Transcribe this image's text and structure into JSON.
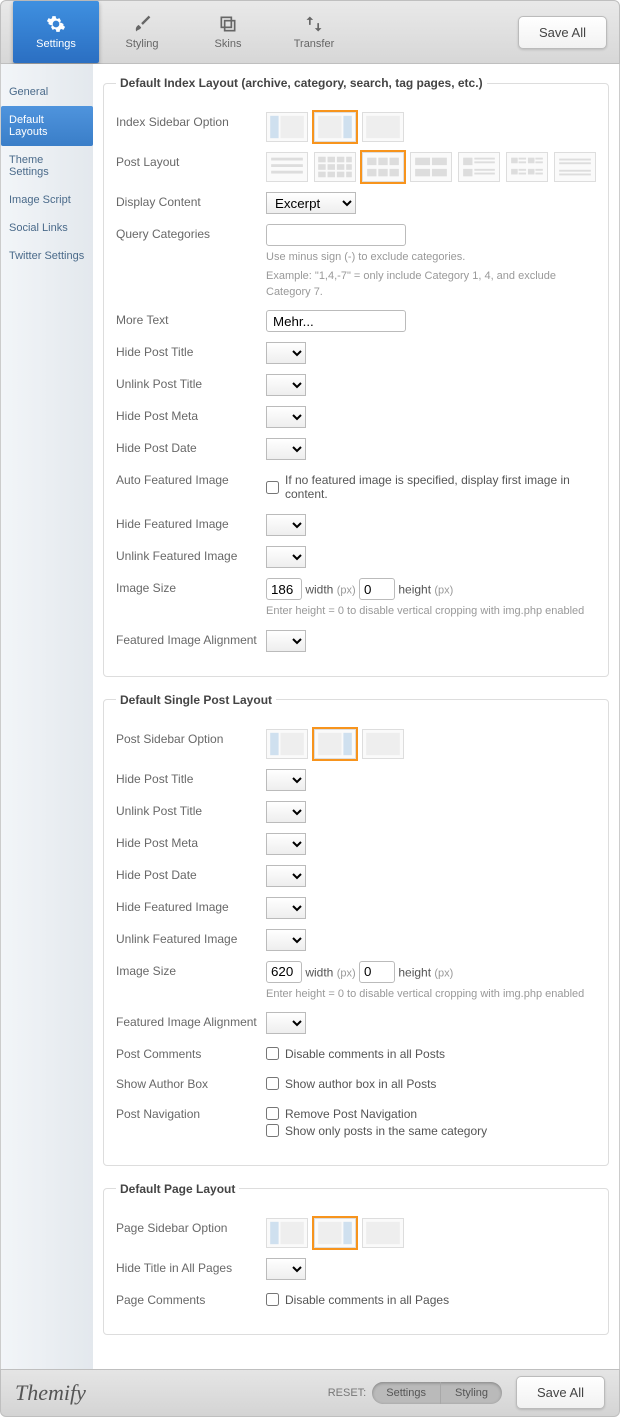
{
  "topbar": {
    "tabs": [
      {
        "label": "Settings",
        "active": true
      },
      {
        "label": "Styling",
        "active": false
      },
      {
        "label": "Skins",
        "active": false
      },
      {
        "label": "Transfer",
        "active": false
      }
    ],
    "save": "Save All"
  },
  "sidebar": {
    "items": [
      {
        "label": "General",
        "active": false
      },
      {
        "label": "Default Layouts",
        "active": true
      },
      {
        "label": "Theme Settings",
        "active": false
      },
      {
        "label": "Image Script",
        "active": false
      },
      {
        "label": "Social Links",
        "active": false
      },
      {
        "label": "Twitter Settings",
        "active": false
      }
    ]
  },
  "sections": {
    "index": {
      "legend": "Default Index Layout (archive, category, search, tag pages, etc.)",
      "sidebar_option": {
        "label": "Index Sidebar Option",
        "selected": 1,
        "count": 3
      },
      "post_layout": {
        "label": "Post Layout",
        "selected": 2,
        "count": 7
      },
      "display_content": {
        "label": "Display Content",
        "value": "Excerpt"
      },
      "query_categories": {
        "label": "Query Categories",
        "value": "",
        "hint1": "Use minus sign (-) to exclude categories.",
        "hint2": "Example: \"1,4,-7\" = only include Category 1, 4, and exclude Category 7."
      },
      "more_text": {
        "label": "More Text",
        "value": "Mehr..."
      },
      "hide_post_title": {
        "label": "Hide Post Title"
      },
      "unlink_post_title": {
        "label": "Unlink Post Title"
      },
      "hide_post_meta": {
        "label": "Hide Post Meta"
      },
      "hide_post_date": {
        "label": "Hide Post Date"
      },
      "auto_featured": {
        "label": "Auto Featured Image",
        "check_label": "If no featured image is specified, display first image in content."
      },
      "hide_featured": {
        "label": "Hide Featured Image"
      },
      "unlink_featured": {
        "label": "Unlink Featured Image"
      },
      "image_size": {
        "label": "Image Size",
        "w": "186",
        "h": "0",
        "w_lbl": "width",
        "h_lbl": "height",
        "px": "(px)",
        "hint": "Enter height = 0 to disable vertical cropping with img.php enabled"
      },
      "featured_align": {
        "label": "Featured Image Alignment"
      }
    },
    "single": {
      "legend": "Default Single Post Layout",
      "sidebar_option": {
        "label": "Post Sidebar Option",
        "selected": 1,
        "count": 3
      },
      "hide_post_title": {
        "label": "Hide Post Title"
      },
      "unlink_post_title": {
        "label": "Unlink Post Title"
      },
      "hide_post_meta": {
        "label": "Hide Post Meta"
      },
      "hide_post_date": {
        "label": "Hide Post Date"
      },
      "hide_featured": {
        "label": "Hide Featured Image"
      },
      "unlink_featured": {
        "label": "Unlink Featured Image"
      },
      "image_size": {
        "label": "Image Size",
        "w": "620",
        "h": "0",
        "w_lbl": "width",
        "h_lbl": "height",
        "px": "(px)",
        "hint": "Enter height = 0 to disable vertical cropping with img.php enabled"
      },
      "featured_align": {
        "label": "Featured Image Alignment"
      },
      "post_comments": {
        "label": "Post Comments",
        "check_label": "Disable comments in all Posts"
      },
      "author_box": {
        "label": "Show Author Box",
        "check_label": "Show author box in all Posts"
      },
      "post_nav": {
        "label": "Post Navigation",
        "check1": "Remove Post Navigation",
        "check2": "Show only posts in the same category"
      }
    },
    "page": {
      "legend": "Default Page Layout",
      "sidebar_option": {
        "label": "Page Sidebar Option",
        "selected": 1,
        "count": 3
      },
      "hide_title": {
        "label": "Hide Title in All Pages"
      },
      "page_comments": {
        "label": "Page Comments",
        "check_label": "Disable comments in all Pages"
      }
    }
  },
  "footer": {
    "brand": "Themify",
    "reset_label": "RESET:",
    "reset_settings": "Settings",
    "reset_styling": "Styling",
    "save": "Save All"
  }
}
